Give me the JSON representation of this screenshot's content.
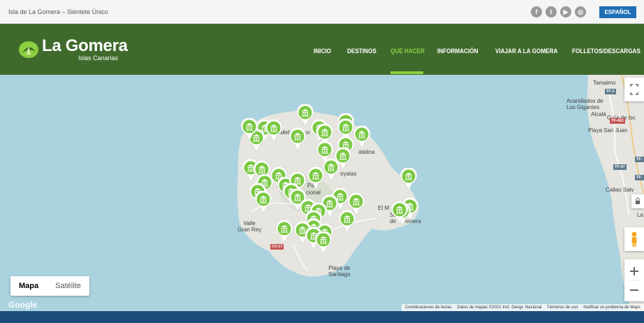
{
  "topbar": {
    "tagline": "Isla de La Gomera – Siéntete Único",
    "social_icons": [
      "facebook-icon",
      "twitter-icon",
      "youtube-icon",
      "instagram-icon"
    ],
    "language_label": "ESPAÑOL"
  },
  "header": {
    "logo_title": "La Gomera",
    "logo_subtitle": "Islas Canarias",
    "nav": [
      {
        "label": "INICIO",
        "active": false
      },
      {
        "label": "DESTINOS",
        "active": false
      },
      {
        "label": "QUÉ HACER",
        "active": true
      },
      {
        "label": "INFORMACIÓN",
        "active": false
      },
      {
        "label": "VIAJAR A LA GOMERA",
        "active": false
      },
      {
        "label": "FOLLETOS/DESCARGAS",
        "active": false
      }
    ]
  },
  "colors": {
    "nav_background": "#3f6a2c",
    "accent_green": "#8ccf3f",
    "marker_green": "#7ac943",
    "language_button": "#1f6fb6",
    "sea": "#aad3df"
  },
  "map": {
    "labels": {
      "vallehermoso": "allehermoso",
      "san_sebastian_a": "San",
      "san_sebastian_b": "de",
      "san_sebastian_c": "omera",
      "el_m": "El M",
      "catalina": "atalina",
      "ceyatas": "oyatas",
      "park_a": "Pa",
      "park_b": "cional",
      "valle_gran_rey": "Valle\nGran Rey",
      "playa_santiago": "Playa de\nSantiago",
      "tamaimo": "Tamaimo",
      "acantilados": "Acantilados de\nLos Gigantes",
      "guia": "Guía de Isc",
      "alcala": "Alcalá",
      "playa_san_juan": "Playa San Juan",
      "callao": "Callao Salv",
      "la": "La"
    },
    "road_badges": {
      "tf1": "TF-1",
      "tf463": "TF-463",
      "tf47": "TF-47",
      "tf": "TF-",
      "tf_b": "TF-",
      "cv": "CV-17"
    },
    "marker_icon": "museum-icon",
    "map_types": [
      "Mapa",
      "Satélite"
    ],
    "selected_map_type": "Mapa",
    "controls": [
      "fullscreen-icon",
      "pegman-icon",
      "zoom-in-icon",
      "zoom-out-icon"
    ],
    "google": "Google",
    "attribution": [
      "Combinaciones de teclas",
      "Datos de mapas ©2021 Inst. Geogr. Nacional",
      "Términos de uso",
      "Notificar un problema de Maps"
    ]
  }
}
